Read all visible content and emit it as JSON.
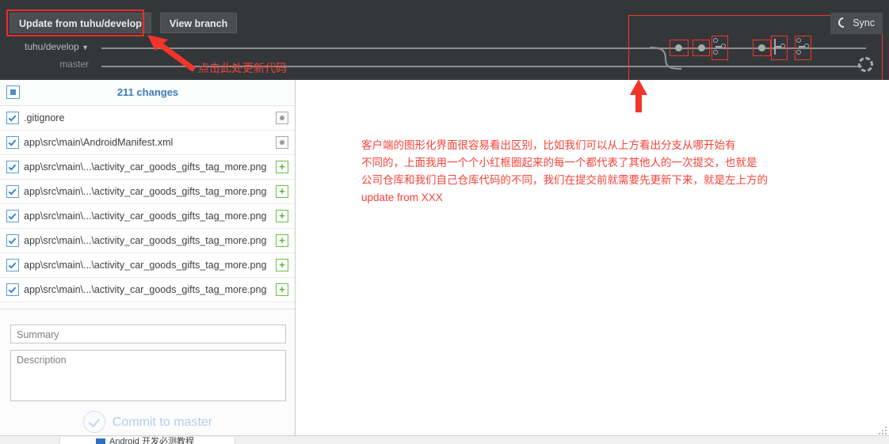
{
  "toolbar": {
    "update_button": "Update from tuhu/develop",
    "view_branch_button": "View branch",
    "sync_button": "Sync",
    "sync_icon": "refresh-icon"
  },
  "branches": {
    "current": "tuhu/develop",
    "caret": "▼",
    "other": "master"
  },
  "changes": {
    "header": "211 changes",
    "select_all_state": "indeterminate",
    "files": [
      {
        "name": ".gitignore",
        "status": "modified",
        "status_glyph": "●",
        "checked": true
      },
      {
        "name": "app\\src\\main\\AndroidManifest.xml",
        "status": "modified",
        "status_glyph": "●",
        "checked": true
      },
      {
        "name": "app\\src\\main\\...\\activity_car_goods_gifts_tag_more.png",
        "status": "added",
        "status_glyph": "+",
        "checked": true
      },
      {
        "name": "app\\src\\main\\...\\activity_car_goods_gifts_tag_more.png",
        "status": "added",
        "status_glyph": "+",
        "checked": true
      },
      {
        "name": "app\\src\\main\\...\\activity_car_goods_gifts_tag_more.png",
        "status": "added",
        "status_glyph": "+",
        "checked": true
      },
      {
        "name": "app\\src\\main\\...\\activity_car_goods_gifts_tag_more.png",
        "status": "added",
        "status_glyph": "+",
        "checked": true
      },
      {
        "name": "app\\src\\main\\...\\activity_car_goods_gifts_tag_more.png",
        "status": "added",
        "status_glyph": "+",
        "checked": true
      },
      {
        "name": "app\\src\\main\\...\\activity_car_goods_gifts_tag_more.png",
        "status": "added",
        "status_glyph": "+",
        "checked": true
      }
    ]
  },
  "commit_form": {
    "summary_placeholder": "Summary",
    "summary_value": "",
    "description_placeholder": "Description",
    "description_value": "",
    "commit_button": "Commit to master"
  },
  "annotations": {
    "arrow_label": "点击此处更新代码",
    "main_text_lines": [
      "客户端的图形化界面很容易看出区别，比如我们可以从上方看出分支从哪开始有",
      "不同的，上面我用一个个小红框圈起来的每一个都代表了其他人的一次提交，也就是",
      "公司仓库和我们自己仓库代码的不同，我们在提交前就需要先更新下来，就是左上方的",
      "update from XXX"
    ],
    "color": "#f4433a"
  },
  "taskbar": {
    "item_label": "Android 开发必测教程"
  },
  "colors": {
    "toolbar_bg": "#33373a",
    "button_bg": "#4a4e51",
    "accent_blue": "#3b7cbe",
    "annotation_red": "#f4433a",
    "added_green": "#6cbd45",
    "graph_line": "#8c8f91"
  }
}
